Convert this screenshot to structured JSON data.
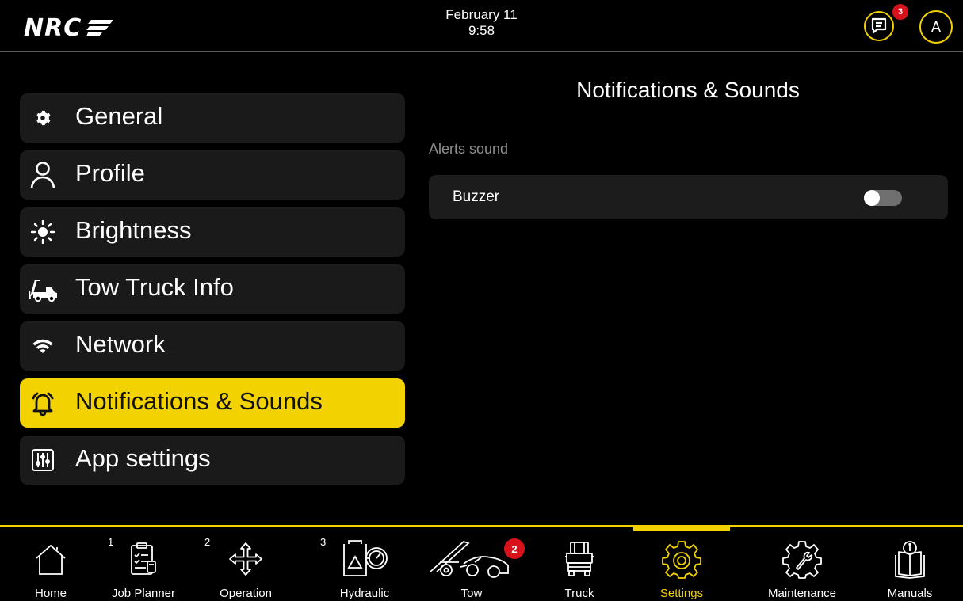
{
  "header": {
    "logo_text": "NRC",
    "date": "February 11",
    "time": "9:58",
    "chat_badge": "3",
    "avatar_initial": "A",
    "accent_color": "#f2d200"
  },
  "sidebar": {
    "items": [
      {
        "label": "General",
        "icon": "gear-icon",
        "active": false
      },
      {
        "label": "Profile",
        "icon": "user-icon",
        "active": false
      },
      {
        "label": "Brightness",
        "icon": "sun-icon",
        "active": false
      },
      {
        "label": "Tow Truck Info",
        "icon": "tow-truck-icon",
        "active": false
      },
      {
        "label": "Network",
        "icon": "wifi-icon",
        "active": false
      },
      {
        "label": "Notifications & Sounds",
        "icon": "bell-icon",
        "active": true
      },
      {
        "label": "App settings",
        "icon": "sliders-icon",
        "active": false
      }
    ]
  },
  "main": {
    "title": "Notifications & Sounds",
    "section_label": "Alerts sound",
    "settings": [
      {
        "label": "Buzzer",
        "enabled": false
      }
    ]
  },
  "bottom_nav": {
    "items": [
      {
        "label": "Home",
        "icon": "home-icon",
        "number": ""
      },
      {
        "label": "Job Planner",
        "icon": "clipboard-icon",
        "number": "1"
      },
      {
        "label": "Operation",
        "icon": "move-arrows-icon",
        "number": "2"
      },
      {
        "label": "Hydraulic",
        "icon": "hydraulic-gauge-icon",
        "number": "3"
      },
      {
        "label": "Tow",
        "icon": "tow-car-icon",
        "number": "",
        "badge": "2"
      },
      {
        "label": "Truck",
        "icon": "truck-icon",
        "number": ""
      },
      {
        "label": "Settings",
        "icon": "settings-gear-icon",
        "number": "",
        "active": true
      },
      {
        "label": "Maintenance",
        "icon": "maintenance-gear-icon",
        "number": ""
      },
      {
        "label": "Manuals",
        "icon": "manual-book-icon",
        "number": ""
      }
    ]
  }
}
